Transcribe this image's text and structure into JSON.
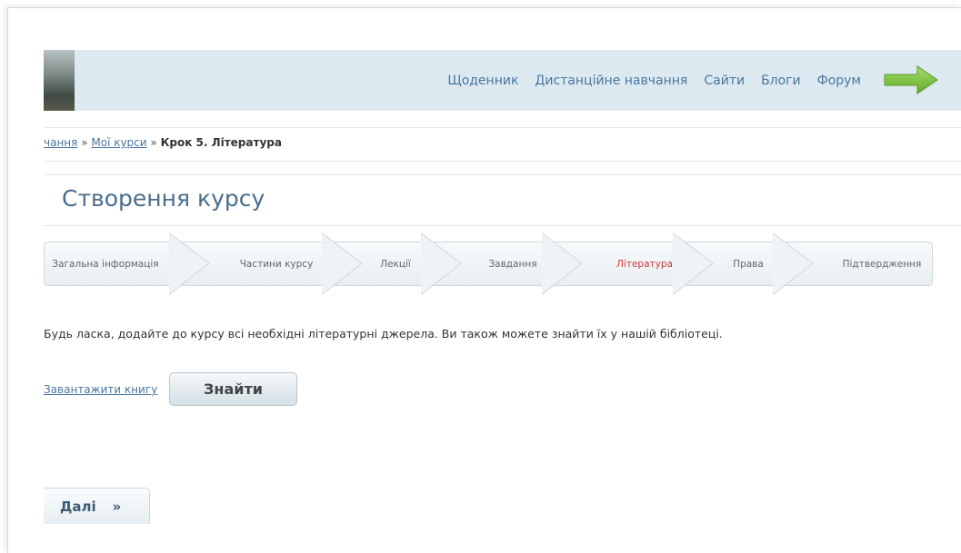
{
  "header": {
    "nav": [
      "Щоденник",
      "Дистанційне навчання",
      "Сайти",
      "Блоги",
      "Форум"
    ]
  },
  "breadcrumb": {
    "part1": "чання",
    "sep": "»",
    "part2": "Мої курси",
    "current": "Крок 5. Література"
  },
  "page": {
    "title": "Створення курсу"
  },
  "steps": [
    {
      "label": "Загальна інформація",
      "active": false
    },
    {
      "label": "Частини курсу",
      "active": false
    },
    {
      "label": "Лекції",
      "active": false
    },
    {
      "label": "Завдання",
      "active": false
    },
    {
      "label": "Література",
      "active": true
    },
    {
      "label": "Права",
      "active": false
    },
    {
      "label": "Підтвердження",
      "active": false
    }
  ],
  "content": {
    "info": "Будь ласка, додайте до курсу всі необхідні літературні джерела. Ви також можете знайти їх у нашій бібліотеці.",
    "upload_link": "Завантажити книгу",
    "find_button": "Знайти",
    "next_button": "Далі",
    "next_arrow": "»"
  },
  "colors": {
    "header_bg": "#dde9f0",
    "link": "#4a76a0",
    "active_step": "#c73a3a",
    "arrow": "#7cc242"
  }
}
